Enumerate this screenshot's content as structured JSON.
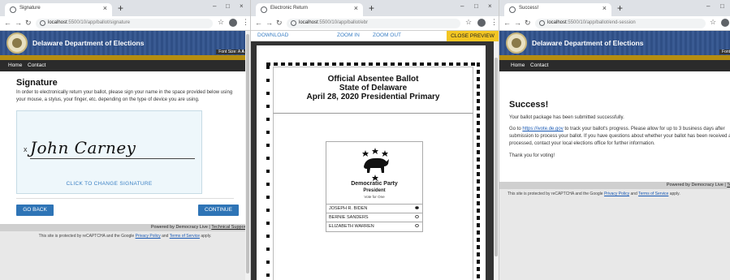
{
  "windows": [
    {
      "tab_title": "Signature",
      "url_prefix": "localhost",
      "url_path": ":5500/10/app/ballot/signature"
    },
    {
      "tab_title": "Electronic Return",
      "url_prefix": "localhost",
      "url_path": ":5500/10/app/ballot/ebr"
    },
    {
      "tab_title": "Success!",
      "url_prefix": "localhost",
      "url_path": ":5500/10/app/ballot/end-session"
    }
  ],
  "site": {
    "title": "Delaware Department of Elections",
    "font_size_label": "Font Size: A",
    "font_size_big": "A",
    "nav": [
      "Home",
      "Contact"
    ],
    "footer": "Powered by Democracy Live | ",
    "footer_link": "Technical Support",
    "captcha_prefix": "This site is protected by reCAPTCHA and the Google ",
    "captcha_privacy": "Privacy Policy",
    "captcha_and": " and ",
    "captcha_terms": "Terms of Service",
    "captcha_suffix": " apply."
  },
  "signature_page": {
    "heading": "Signature",
    "instructions": "In order to electronically return your ballot, please sign your name in the space provided below using your mouse, a stylus, your finger, etc. depending on the type of device you are using.",
    "signature_x": "x",
    "signature_name": "John Carney",
    "change_signature": "CLICK TO CHANGE SIGNATURE",
    "go_back": "GO BACK",
    "continue": "CONTINUE"
  },
  "preview": {
    "download": "DOWNLOAD",
    "zoom_in": "ZOOM IN",
    "zoom_out": "ZOOM OUT",
    "close": "CLOSE PREVIEW",
    "ballot_title_1": "Official Absentee Ballot",
    "ballot_title_2": "State of Delaware",
    "ballot_title_3": "April 28, 2020 Presidential Primary",
    "party": "Democratic Party",
    "office": "President",
    "vote_for": "Vote for One",
    "candidates": [
      {
        "name": "JOSEPH R. BIDEN",
        "selected": true
      },
      {
        "name": "BERNIE SANDERS",
        "selected": false
      },
      {
        "name": "ELIZABETH WARREN",
        "selected": false
      }
    ]
  },
  "success_page": {
    "heading": "Success!",
    "line1": "Your ballot package has been submitted successfully.",
    "line2_prefix": "Go to ",
    "line2_link": "https://ivote.de.gov",
    "line2_rest": " to track your ballot's progress. Please allow for up to 3 business days after submission to process your ballot.  If you have questions about whether your ballot has been received and processed, contact your local elections office for further information.",
    "line3": "Thank you for voting!"
  },
  "icons": {
    "back": "arrow-left-icon",
    "forward": "arrow-right-icon",
    "reload": "reload-icon",
    "info": "info-icon",
    "star": "star-icon",
    "account": "account-icon",
    "menu": "kebab-menu-icon"
  },
  "colors": {
    "banner": "#2f4f86",
    "gold": "#b58d10",
    "button": "#2e74b6",
    "close_preview": "#f3c623"
  }
}
